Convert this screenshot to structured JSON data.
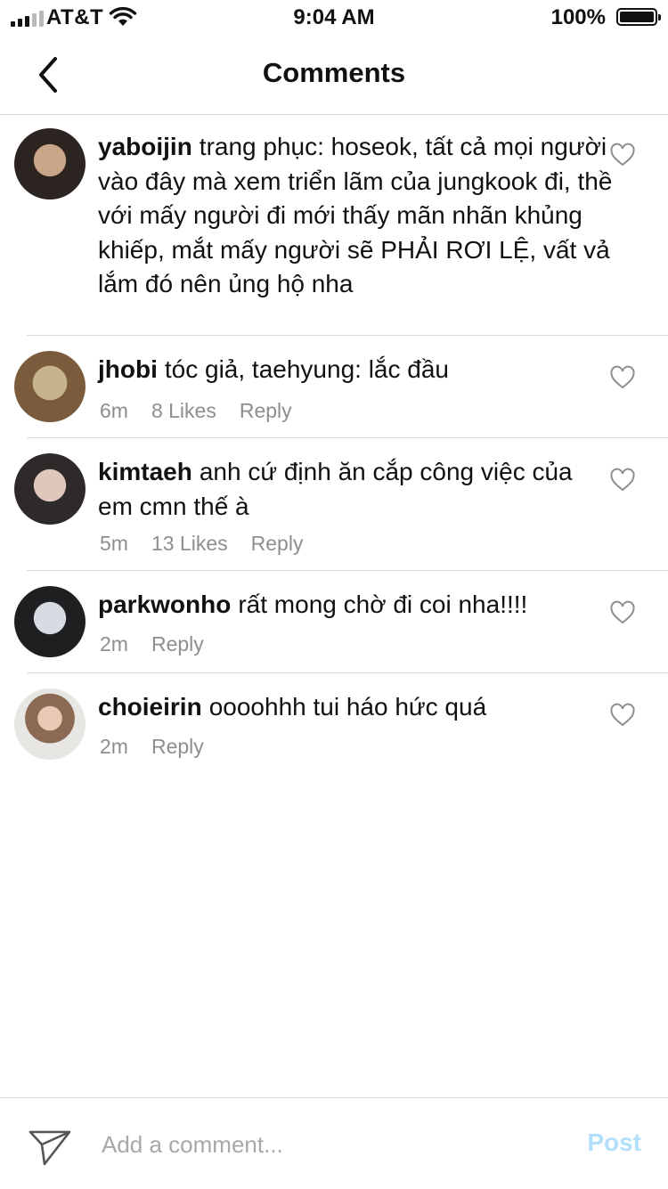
{
  "status_bar": {
    "carrier": "AT&T",
    "time": "9:04 AM",
    "battery": "100%"
  },
  "header": {
    "title": "Comments",
    "back_icon": "chevron-left-icon"
  },
  "comments": [
    {
      "username": "yaboijin",
      "text": "trang phục: hoseok, tất cả mọi người vào đây mà xem triển lãm của jungkook đi, thề với mấy người đi mới thấy mãn nhãn khủng khiếp, mắt mấy người sẽ PHẢI RƠI LỆ, vất vả lắm đó nên ủng hộ nha",
      "avatar_colors": [
        "#c9a58a",
        "#2b2420"
      ]
    },
    {
      "username": "jhobi",
      "text": "tóc giả, taehyung: lắc đầu",
      "time": "6m",
      "likes": "8 Likes",
      "reply": "Reply",
      "avatar_colors": [
        "#c8b48c",
        "#7a5b3c"
      ]
    },
    {
      "username": "kimtaeh",
      "text": "anh cứ định ăn cắp công việc của em cmn thế à",
      "time": "5m",
      "likes": "13 Likes",
      "reply": "Reply",
      "avatar_colors": [
        "#e0c7bd",
        "#2e2a29"
      ]
    },
    {
      "username": "parkwonho",
      "text": "rất mong chờ đi coi nha!!!!",
      "time": "2m",
      "reply": "Reply",
      "avatar_colors": [
        "#d7dce3",
        "#1f1f22"
      ]
    },
    {
      "username": "choieirin",
      "text": "oooohhh tui háo hức quá",
      "time": "2m",
      "reply": "Reply",
      "avatar_colors": [
        "#e8e6e3",
        "#8a6a52"
      ]
    }
  ],
  "composer": {
    "placeholder": "Add a comment...",
    "post_label": "Post",
    "send_icon": "paper-plane-icon"
  },
  "colors": {
    "accent_disabled": "#b2dffc",
    "meta_text": "#8e8e8e",
    "separator": "#dbdbdb"
  }
}
